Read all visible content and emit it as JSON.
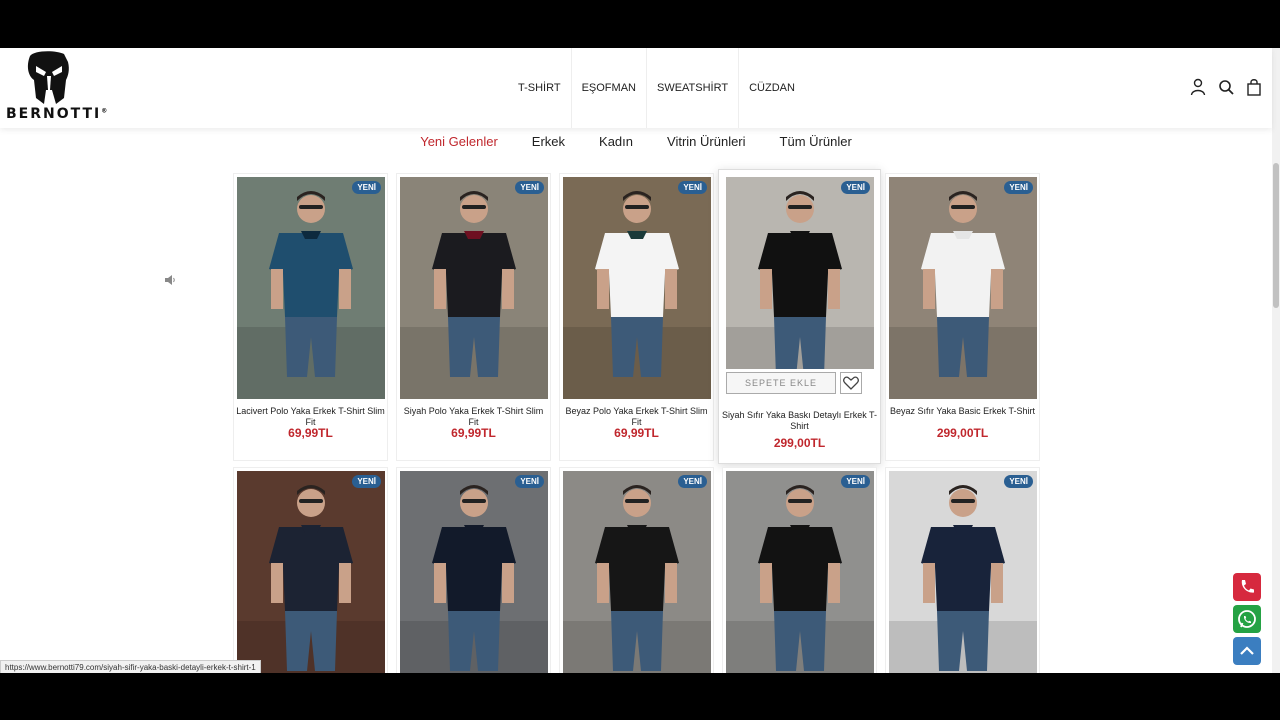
{
  "brand": {
    "name": "BERNOTTI",
    "mark": "®"
  },
  "nav": {
    "items": [
      "T-SHİRT",
      "EŞOFMAN",
      "SWEATSHİRT",
      "CÜZDAN"
    ]
  },
  "header_icons": [
    "user-icon",
    "search-icon",
    "bag-icon"
  ],
  "tabs": [
    {
      "label": "Yeni Gelenler",
      "active": true
    },
    {
      "label": "Erkek",
      "active": false
    },
    {
      "label": "Kadın",
      "active": false
    },
    {
      "label": "Vitrin Ürünleri",
      "active": false
    },
    {
      "label": "Tüm Ürünler",
      "active": false
    }
  ],
  "badge_label": "YENİ",
  "products": [
    {
      "name": "Lacivert Polo Yaka Erkek T-Shirt Slim Fit",
      "price": "69,99TL",
      "shirt": "#1f4e6e",
      "collar": "#0d2a3e"
    },
    {
      "name": "Siyah Polo Yaka Erkek T-Shirt Slim Fit",
      "price": "69,99TL",
      "shirt": "#1b1b1f",
      "collar": "#6e1021"
    },
    {
      "name": "Beyaz Polo Yaka Erkek T-Shirt Slim Fit",
      "price": "69,99TL",
      "shirt": "#f4f4f4",
      "collar": "#1a3a3a"
    },
    {
      "name": "Siyah Sıfır Yaka Baskı Detaylı Erkek T-Shirt",
      "price": "299,00TL",
      "shirt": "#111111",
      "collar": "#111111"
    },
    {
      "name": "Beyaz Sıfır Yaka Basic Erkek T-Shirt",
      "price": "299,00TL",
      "shirt": "#f2f2f2",
      "collar": "#e5e5e5"
    },
    {
      "name": "",
      "price": "",
      "shirt": "#1c2333",
      "collar": "#1c2333"
    },
    {
      "name": "",
      "price": "",
      "shirt": "#121a2a",
      "collar": "#121a2a"
    },
    {
      "name": "",
      "price": "",
      "shirt": "#161616",
      "collar": "#161616"
    },
    {
      "name": "",
      "price": "",
      "shirt": "#121212",
      "collar": "#121212"
    },
    {
      "name": "",
      "price": "",
      "shirt": "#18233a",
      "collar": "#18233a"
    }
  ],
  "hover_card": {
    "add_to_cart": "SEPETE EKLE"
  },
  "status_url": "https://www.bernotti79.com/siyah-sifir-yaka-baski-detayli-erkek-t-shirt-1",
  "colors": {
    "accent": "#c0272d",
    "badge": "#2a5f92",
    "phone": "#d6293e",
    "whatsapp": "#25a244",
    "scroll_top": "#3b7ec0"
  }
}
